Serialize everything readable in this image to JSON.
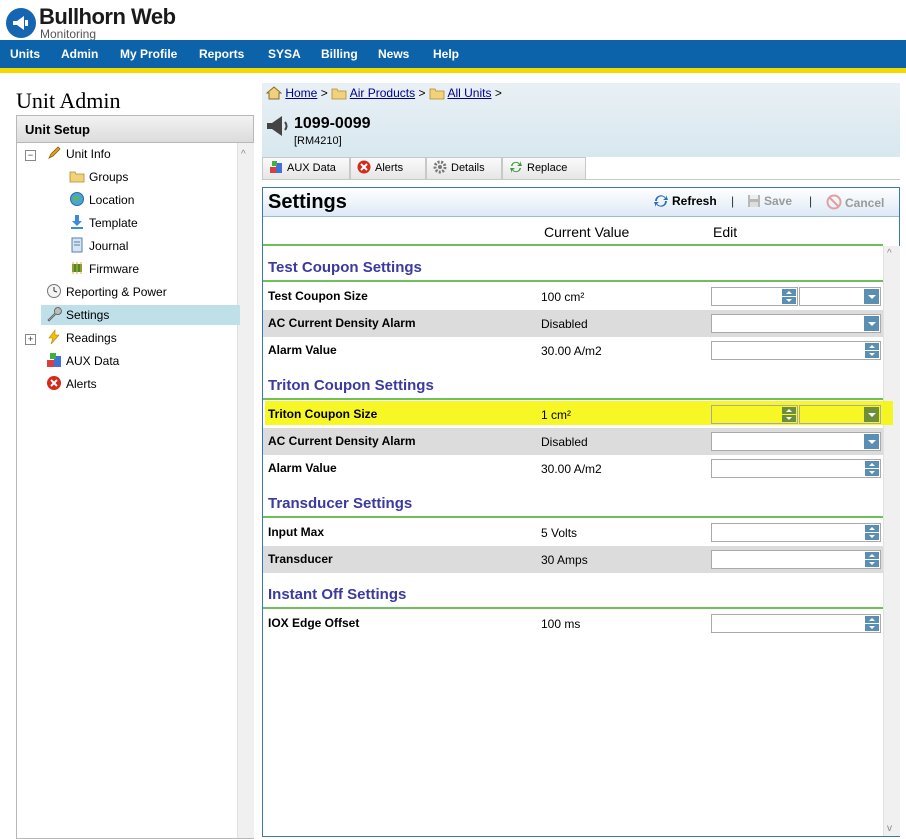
{
  "app": {
    "title": "Bullhorn Web",
    "subtitle": "Monitoring"
  },
  "nav": [
    "Units",
    "Admin",
    "My Profile",
    "Reports",
    "SYSA",
    "Billing",
    "News",
    "Help"
  ],
  "left": {
    "page_title": "Unit Admin",
    "panel_title": "Unit Setup",
    "tree": {
      "unit_info": "Unit Info",
      "groups": "Groups",
      "location": "Location",
      "template": "Template",
      "journal": "Journal",
      "firmware": "Firmware",
      "reporting_power": "Reporting & Power",
      "settings": "Settings",
      "readings": "Readings",
      "aux_data": "AUX Data",
      "alerts": "Alerts"
    }
  },
  "breadcrumb": [
    "Home",
    "Air Products",
    "All Units"
  ],
  "breadcrumb_sep": ">",
  "unit": {
    "id": "1099-0099",
    "model": "[RM4210]"
  },
  "tabs": [
    "AUX Data",
    "Alerts",
    "Details",
    "Replace"
  ],
  "settings": {
    "title": "Settings",
    "refresh": "Refresh",
    "save": "Save",
    "cancel": "Cancel",
    "separator": "|",
    "col_current": "Current Value",
    "col_edit": "Edit",
    "sections": [
      {
        "title": "Test Coupon Settings",
        "rows": [
          {
            "label": "Test Coupon Size",
            "value": "100 cm²"
          },
          {
            "label": "AC Current Density Alarm",
            "value": "Disabled"
          },
          {
            "label": "Alarm Value",
            "value": "30.00 A/m2"
          }
        ]
      },
      {
        "title": "Triton Coupon Settings",
        "rows": [
          {
            "label": "Triton Coupon Size",
            "value": "1 cm²"
          },
          {
            "label": "AC Current Density Alarm",
            "value": "Disabled"
          },
          {
            "label": "Alarm Value",
            "value": "30.00 A/m2"
          }
        ]
      },
      {
        "title": "Transducer Settings",
        "rows": [
          {
            "label": "Input Max",
            "value": "5 Volts"
          },
          {
            "label": "Transducer",
            "value": "30 Amps"
          }
        ]
      },
      {
        "title": "Instant Off Settings",
        "rows": [
          {
            "label": "IOX Edge Offset",
            "value": "100 ms"
          }
        ]
      }
    ]
  },
  "colors": {
    "nav_bg": "#0d63a9",
    "nav_stripe": "#f5d800",
    "section_title": "#3a3aa0",
    "section_line": "#6fc05a",
    "highlight": "#f6f600"
  }
}
